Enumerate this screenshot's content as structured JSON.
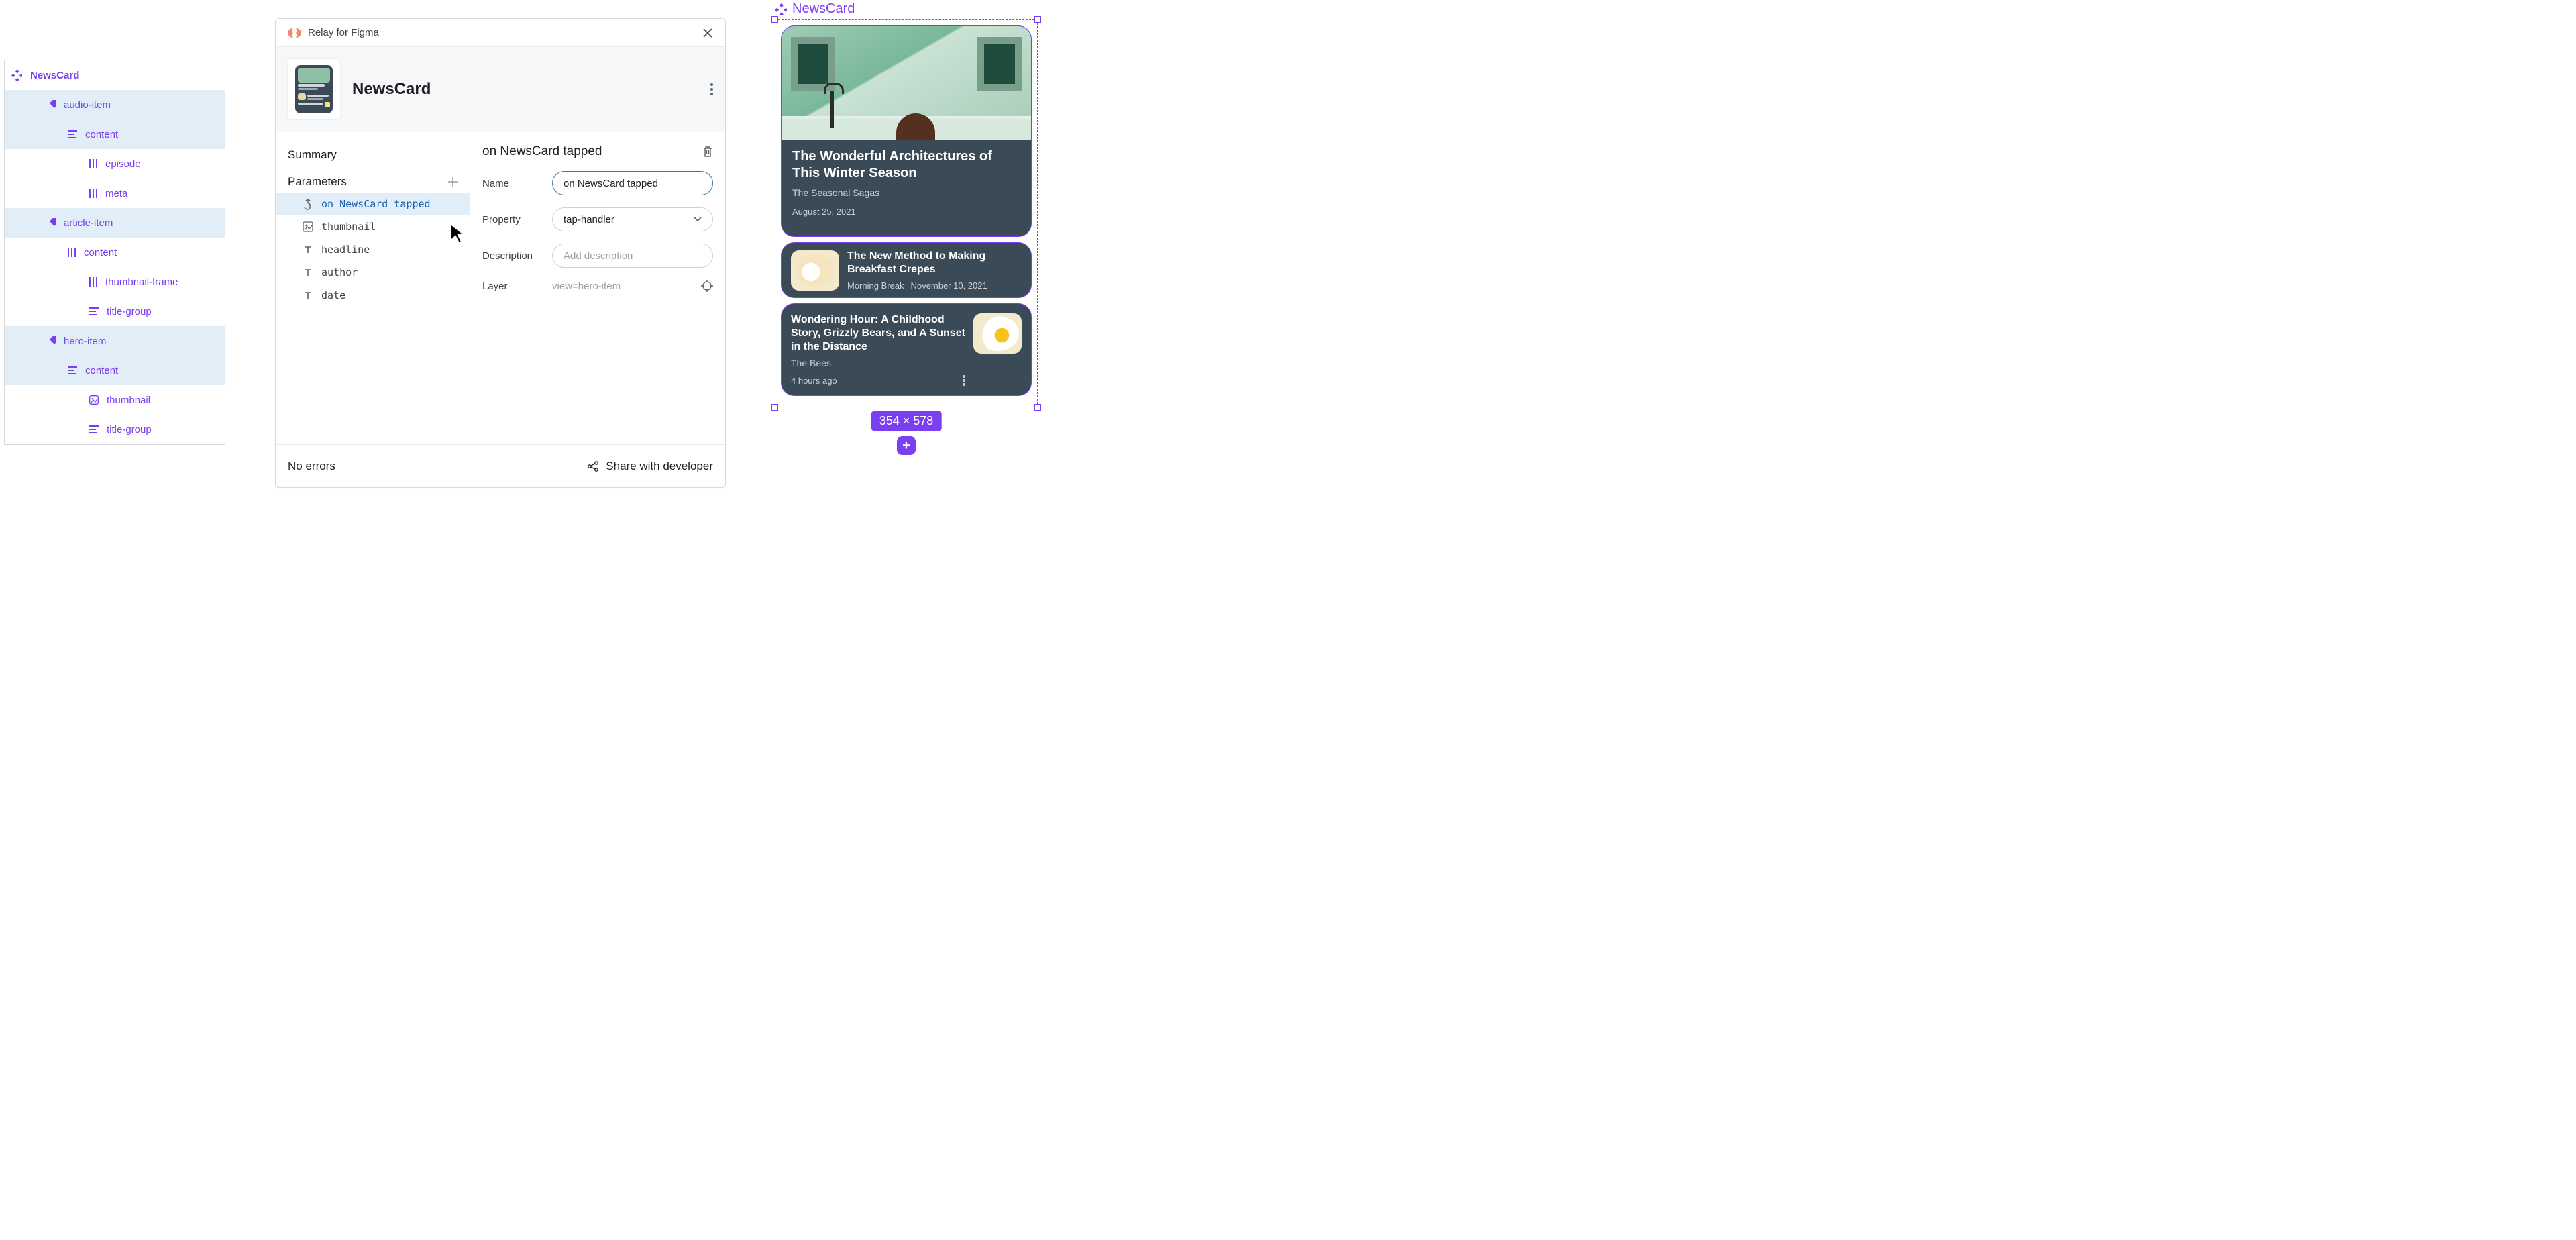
{
  "layers": {
    "root": "NewsCard",
    "rows": [
      {
        "depth": 1,
        "icon": "diamond",
        "label": "audio-item",
        "selected": true
      },
      {
        "depth": 2,
        "icon": "lines",
        "label": "content",
        "selected": true
      },
      {
        "depth": 3,
        "icon": "bars",
        "label": "episode",
        "selected": false
      },
      {
        "depth": 3,
        "icon": "bars",
        "label": "meta",
        "selected": false
      },
      {
        "depth": 1,
        "icon": "diamond",
        "label": "article-item",
        "selected": true
      },
      {
        "depth": 2,
        "icon": "bars",
        "label": "content",
        "selected": false
      },
      {
        "depth": 3,
        "icon": "bars",
        "label": "thumbnail-frame",
        "selected": false
      },
      {
        "depth": 3,
        "icon": "lines",
        "label": "title-group",
        "selected": false
      },
      {
        "depth": 1,
        "icon": "diamond",
        "label": "hero-item",
        "selected": true
      },
      {
        "depth": 2,
        "icon": "lines",
        "label": "content",
        "selected": true
      },
      {
        "depth": 3,
        "icon": "image",
        "label": "thumbnail",
        "selected": false
      },
      {
        "depth": 3,
        "icon": "lines",
        "label": "title-group",
        "selected": false
      }
    ]
  },
  "dialog": {
    "brand": "Relay for Figma",
    "title": "NewsCard",
    "summary_label": "Summary",
    "parameters_label": "Parameters",
    "params": [
      {
        "icon": "tap",
        "label": "on NewsCard tapped",
        "selected": true
      },
      {
        "icon": "image",
        "label": "thumbnail"
      },
      {
        "icon": "text",
        "label": "headline"
      },
      {
        "icon": "text",
        "label": "author"
      },
      {
        "icon": "text",
        "label": "date"
      }
    ],
    "detail": {
      "title": "on NewsCard tapped",
      "name_label": "Name",
      "name_value": "on NewsCard tapped",
      "property_label": "Property",
      "property_value": "tap-handler",
      "description_label": "Description",
      "description_placeholder": "Add description",
      "layer_label": "Layer",
      "layer_value": "view=hero-item"
    },
    "footer_status": "No errors",
    "footer_share": "Share with developer"
  },
  "preview": {
    "label": "NewsCard",
    "size": "354 × 578",
    "hero": {
      "title": "The Wonderful Architectures of This Winter Season",
      "subtitle": "The Seasonal Sagas",
      "date": "August 25, 2021"
    },
    "item1": {
      "title": "The New Method to Making Breakfast Crepes",
      "author": "Morning Break",
      "date": "November 10, 2021"
    },
    "item2": {
      "title": "Wondering Hour: A Childhood Story, Grizzly Bears, and A Sunset in the Distance",
      "author": "The Bees",
      "date": "4 hours ago"
    }
  }
}
